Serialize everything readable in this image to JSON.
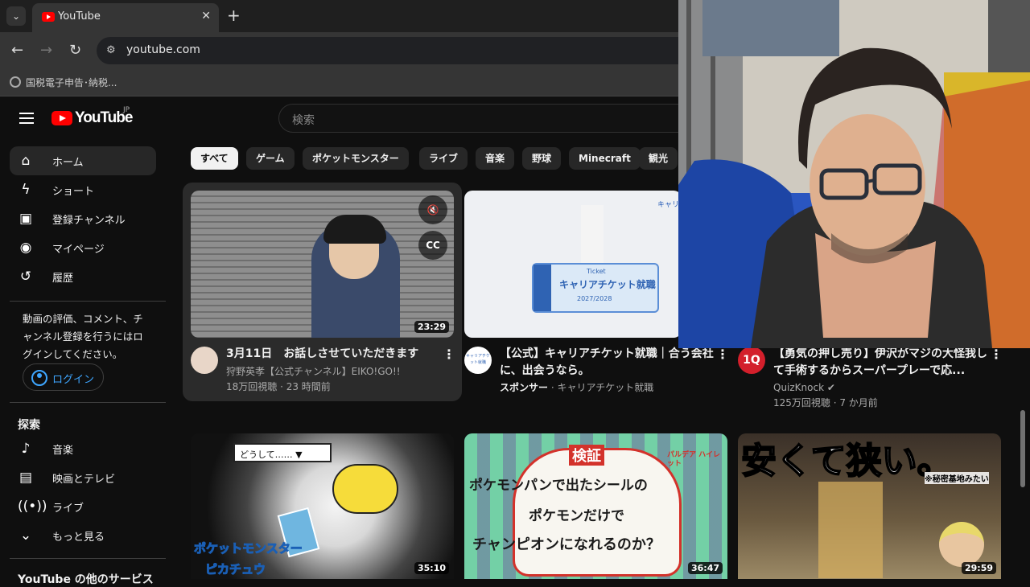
{
  "browser": {
    "tab_title": "YouTube",
    "url": "youtube.com",
    "bookmark": "国税電子申告･納税..."
  },
  "header": {
    "logo_text": "YouTube",
    "logo_region": "JP",
    "search_placeholder": "検索"
  },
  "sidebar": {
    "items": [
      {
        "label": "ホーム",
        "icon": "home-icon"
      },
      {
        "label": "ショート",
        "icon": "shorts-icon"
      },
      {
        "label": "登録チャンネル",
        "icon": "subscriptions-icon"
      },
      {
        "label": "マイページ",
        "icon": "you-icon"
      },
      {
        "label": "履歴",
        "icon": "history-icon"
      }
    ],
    "signin_prompt": "動画の評価、コメント、チャンネル登録を行うにはログインしてください。",
    "login_label": "ログイン",
    "explore_title": "探索",
    "explore_items": [
      {
        "label": "音楽",
        "icon": "music-icon"
      },
      {
        "label": "映画とテレビ",
        "icon": "movies-icon"
      },
      {
        "label": "ライブ",
        "icon": "live-icon"
      },
      {
        "label": "もっと見る",
        "icon": "chevron-down-icon"
      }
    ],
    "more_services": "YouTube の他のサービス"
  },
  "chips": [
    "すべて",
    "ゲーム",
    "ポケットモンスター",
    "ライブ",
    "音楽",
    "野球",
    "Minecraft",
    "観光"
  ],
  "videos": [
    {
      "title": "3月11日　お話しさせていただきます",
      "channel": "狩野英孝【公式チャンネル】EIKO!GO!!",
      "meta": "18万回視聴 · 23 時間前",
      "duration": "23:29",
      "mute_icon": "🔇",
      "cc_label": "CC"
    },
    {
      "title": "【公式】キャリアチケット就職｜合う会社に、出会うなら。",
      "sponsor_label": "スポンサー",
      "channel": "キャリアチケット就職",
      "thumb_ticket_label": "Ticket",
      "thumb_ticket_title": "キャリアチケット就職",
      "thumb_ticket_year": "2027/2028",
      "thumb_corner": "キャリア",
      "avatar_text": "キャリアチケット就職"
    },
    {
      "title": "【勇気の押し売り】伊沢がマジの大怪我して手術するからスーパープレーで応...",
      "channel": "QuizKnock",
      "meta": "125万回視聴 · 7 か月前",
      "avatar_text": "1Q"
    },
    {
      "duration": "35:10",
      "thumb_bubble": "どうして……",
      "thumb_logo": "ポケットモンスター",
      "thumb_logo_sub": "ピカチュウ"
    },
    {
      "duration": "36:47",
      "thumb_head": "検証",
      "thumb_line1": "ポケモンパンで出たシールの",
      "thumb_line2": "ポケモンだけで",
      "thumb_line3": "チャンピオンになれるのか？",
      "thumb_corner": "パルデア ハイレット"
    },
    {
      "duration": "29:59",
      "thumb_headline": "安くて狭い。",
      "thumb_note": "※秘密基地みたい"
    }
  ],
  "colors": {
    "background": "#0f0f0f",
    "brand_red": "#ff0000",
    "link_blue": "#3ea6ff",
    "chip_bg": "#272727"
  }
}
